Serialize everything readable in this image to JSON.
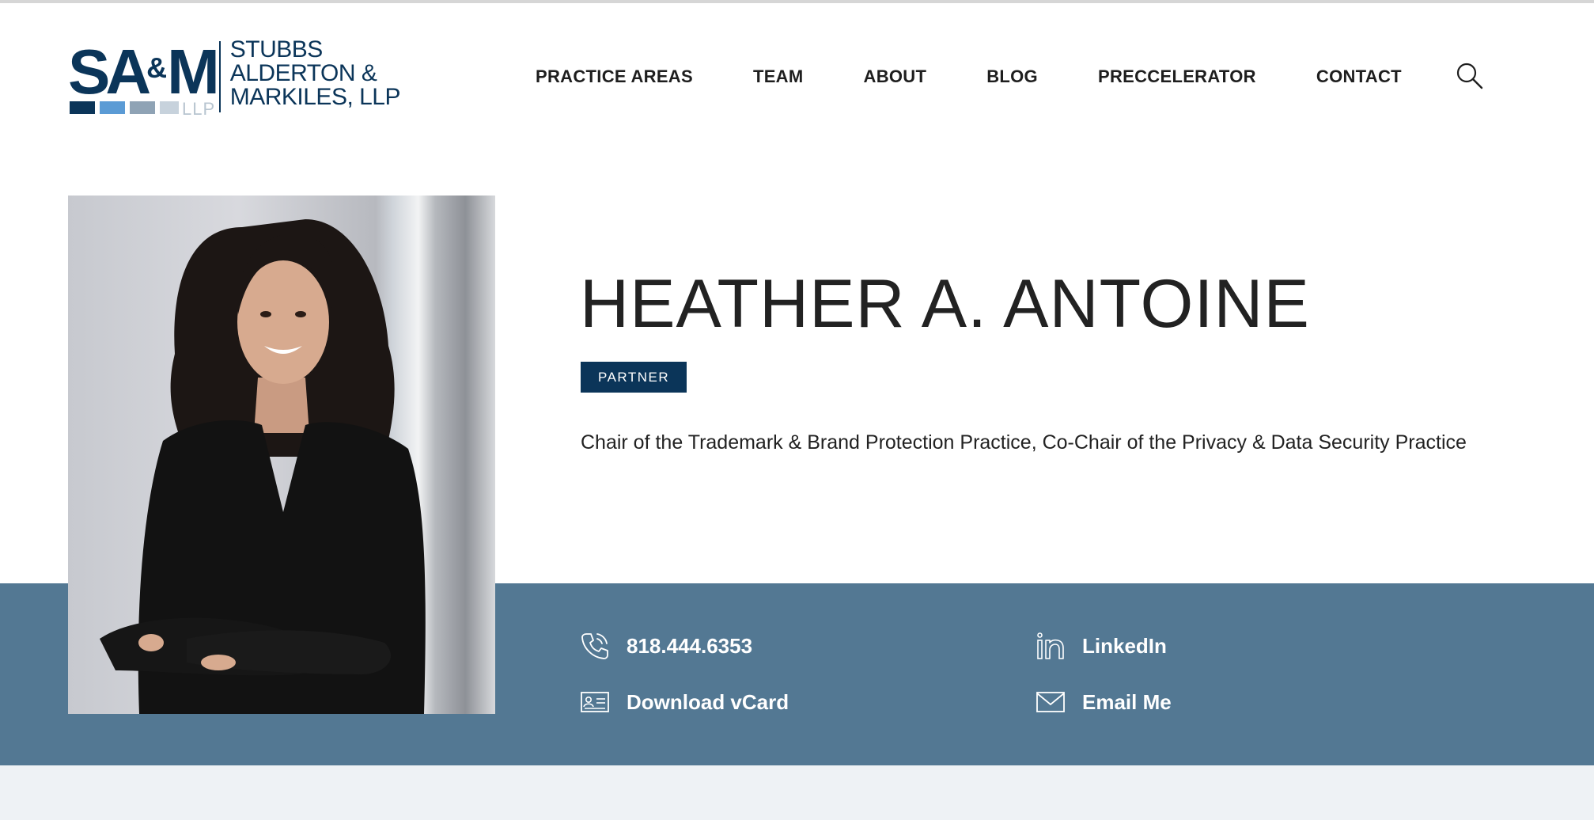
{
  "brand": {
    "mark": "SA",
    "mark_amp": "&",
    "mark_end": "M",
    "llp": "LLP",
    "name_lines": [
      "STUBBS",
      "ALDERTON &",
      "MARKILES, LLP"
    ],
    "colors": {
      "navy": "#0b3559",
      "blue": "#5b9bd5",
      "gray": "#8fa3b5",
      "light": "#c7d2dc"
    }
  },
  "nav": {
    "items": [
      "PRACTICE AREAS",
      "TEAM",
      "ABOUT",
      "BLOG",
      "PRECCELERATOR",
      "CONTACT"
    ],
    "search_icon": "search-icon"
  },
  "profile": {
    "name": "HEATHER A. ANTOINE",
    "role_badge": "PARTNER",
    "title": "Chair of the Trademark & Brand Protection Practice, Co-Chair of the Privacy & Data Security Practice",
    "photo_icon": "portrait-photo"
  },
  "contact": {
    "phone": "818.444.6353",
    "vcard": "Download vCard",
    "linkedin": "LinkedIn",
    "email": "Email Me",
    "band_color": "#537893"
  }
}
